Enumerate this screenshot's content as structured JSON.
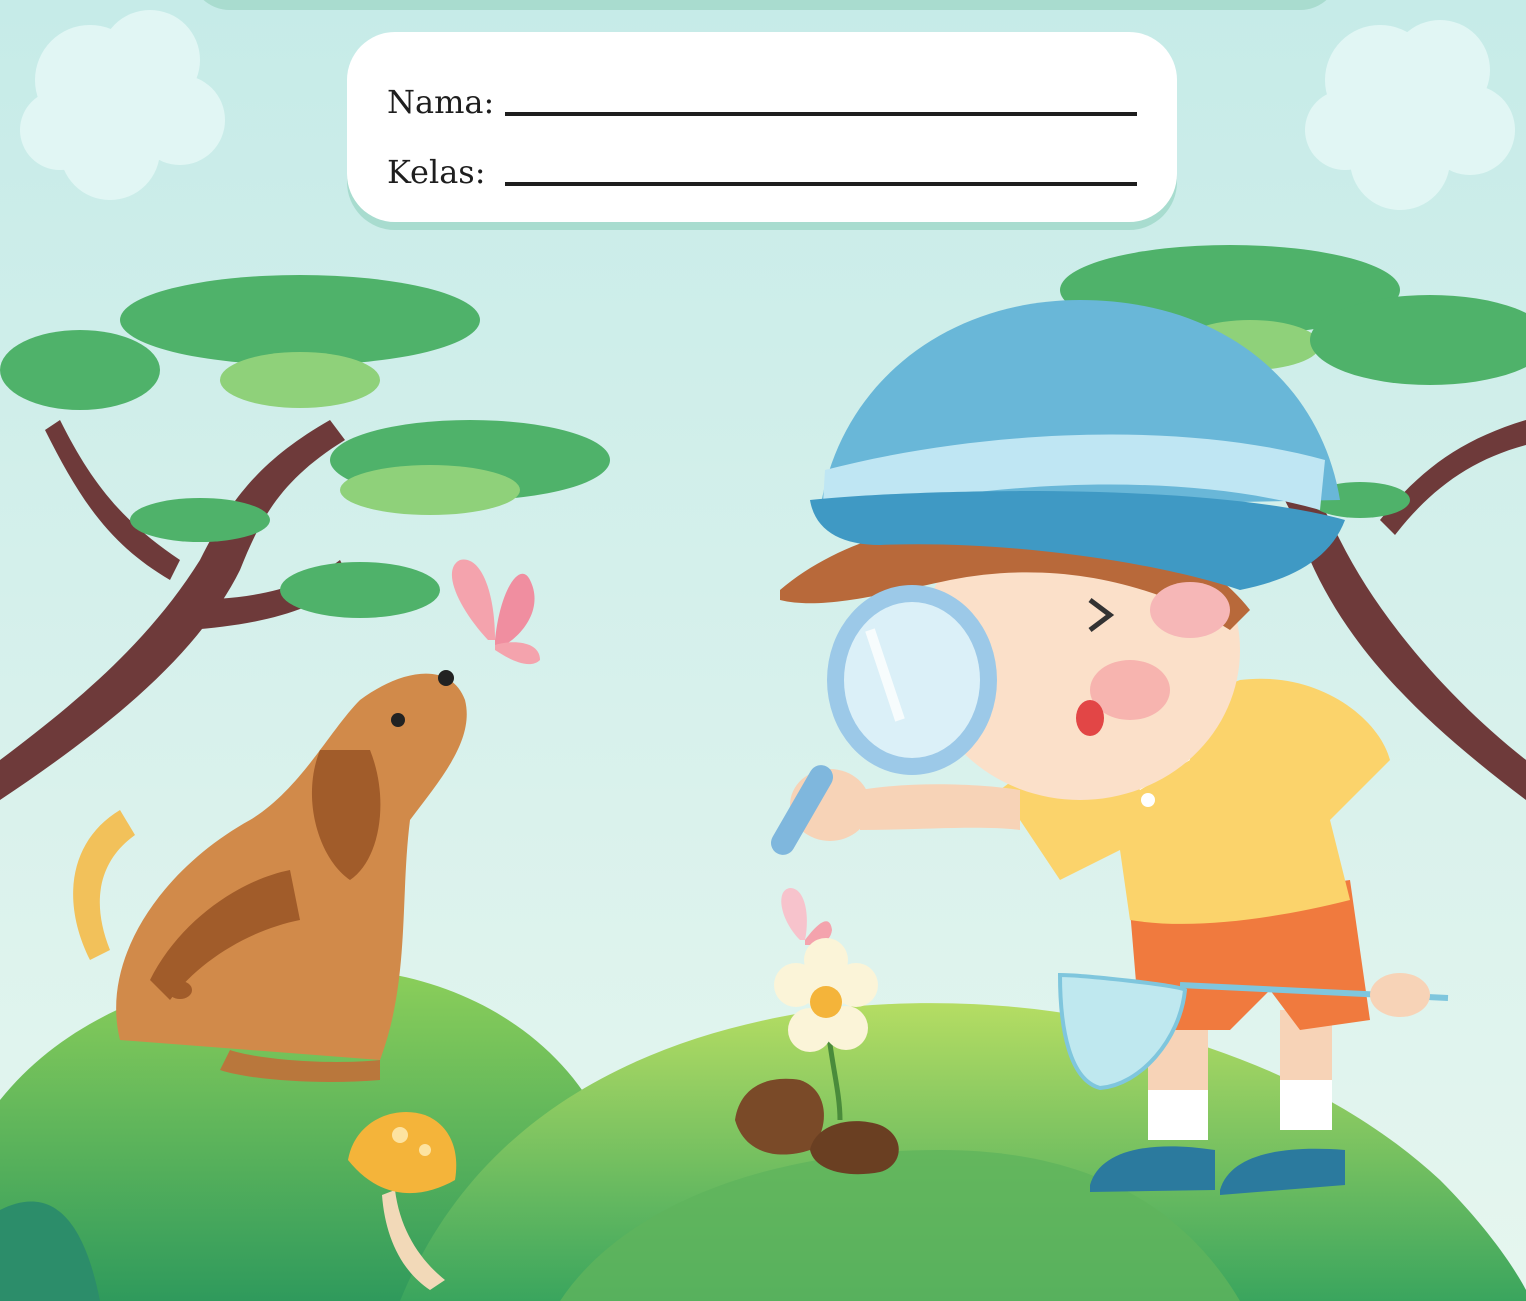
{
  "form": {
    "name_label": "Nama:",
    "class_label": "Kelas:"
  },
  "colors": {
    "sky_top": "#c6ebe8",
    "sky_bottom": "#e6f6ef",
    "card": "#ffffff",
    "card_shadow": "#a8dccf",
    "hill_dark": "#2f9a5c",
    "hill_light": "#9fd35a",
    "tree_leaf": "#4fb26a",
    "tree_trunk": "#6e3a3a",
    "hat": "#69b7d8",
    "shirt": "#fbd36b",
    "shorts": "#f07a3e",
    "dog": "#d18a4a",
    "butterfly": "#f4a3ad"
  },
  "illustration": {
    "icons": [
      "cloud-icon",
      "tree-icon",
      "dog-icon",
      "butterfly-icon",
      "boy-icon",
      "magnifying-glass-icon",
      "flower-icon",
      "mushroom-icon",
      "net-icon",
      "rock-icon"
    ]
  }
}
